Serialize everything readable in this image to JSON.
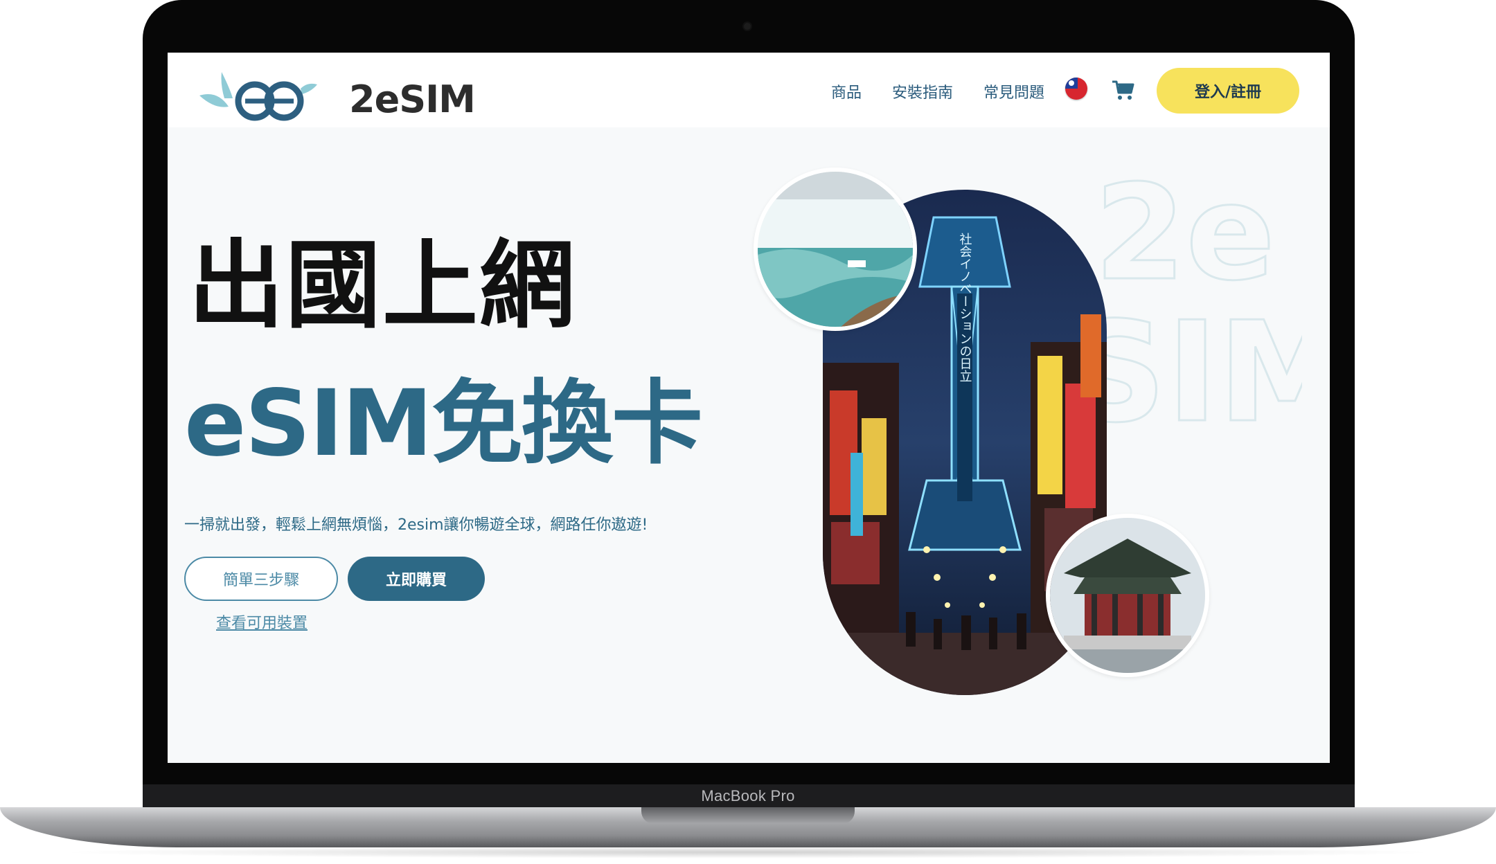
{
  "device": {
    "model_label": "MacBook Pro"
  },
  "header": {
    "logo_text": "2eSIM",
    "nav": [
      {
        "label": "商品"
      },
      {
        "label": "安裝指南"
      },
      {
        "label": "常見問題"
      }
    ],
    "language_icon": "taiwan-flag-icon",
    "cart_icon": "cart-icon",
    "login_label": "登入/註冊",
    "colors": {
      "accent": "#2d6986",
      "login_bg": "#f7e25c"
    }
  },
  "hero": {
    "title_line1": "出國上網",
    "title_line2": "eSIM免換卡",
    "subtitle": "一掃就出發，輕鬆上網無煩惱，2esim讓你暢遊全球，網路任你遨遊!",
    "btn_steps": "簡單三步驟",
    "btn_buy": "立即購買",
    "link_devices": "查看可用裝置",
    "watermark_line1": "2e",
    "watermark_line2": "SIM",
    "tower_sign": "社会イノベーションの日立"
  }
}
